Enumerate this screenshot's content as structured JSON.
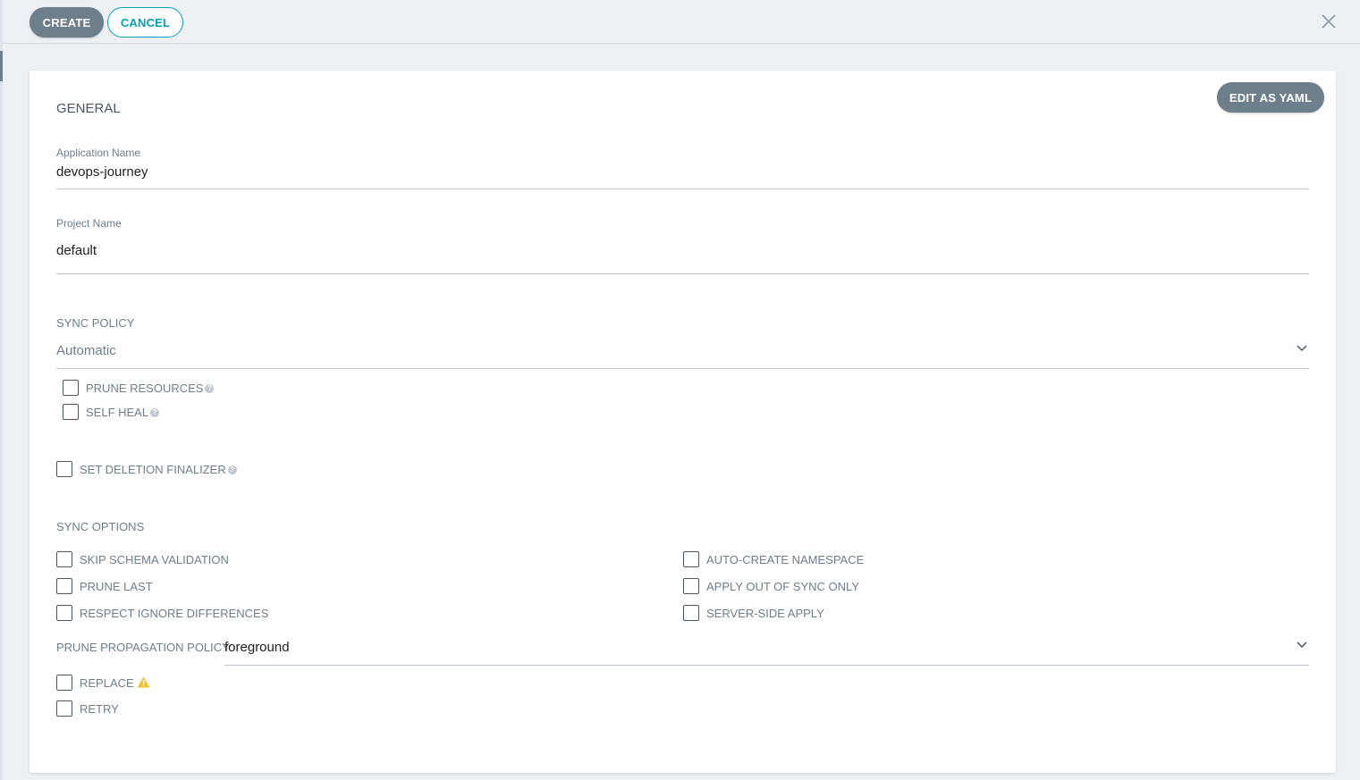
{
  "toolbar": {
    "create_label": "CREATE",
    "cancel_label": "CANCEL",
    "close_icon": "close-icon"
  },
  "panel": {
    "edit_yaml_label": "EDIT AS YAML",
    "general": {
      "title": "GENERAL",
      "application_name": {
        "label": "Application Name",
        "value": "devops-journey"
      },
      "project_name": {
        "label": "Project Name",
        "value": "default"
      }
    },
    "sync_policy": {
      "label": "SYNC POLICY",
      "selected": "Automatic",
      "options": [
        {
          "label": "PRUNE RESOURCES",
          "checked": false,
          "help": true
        },
        {
          "label": "SELF HEAL",
          "checked": false,
          "help": true
        }
      ]
    },
    "deletion_finalizer": {
      "label": "SET DELETION FINALIZER",
      "checked": false,
      "help": true
    },
    "sync_options": {
      "title": "SYNC OPTIONS",
      "left": [
        {
          "label": "SKIP SCHEMA VALIDATION",
          "checked": false
        },
        {
          "label": "PRUNE LAST",
          "checked": false
        },
        {
          "label": "RESPECT IGNORE DIFFERENCES",
          "checked": false
        }
      ],
      "right": [
        {
          "label": "AUTO-CREATE NAMESPACE",
          "checked": false
        },
        {
          "label": "APPLY OUT OF SYNC ONLY",
          "checked": false
        },
        {
          "label": "SERVER-SIDE APPLY",
          "checked": false
        }
      ],
      "prune_propagation_policy": {
        "label": "PRUNE PROPAGATION POLICY:",
        "selected": "foreground"
      },
      "replace": {
        "label": "REPLACE",
        "checked": false,
        "warning_icon": "warning-icon"
      },
      "retry": {
        "label": "RETRY",
        "checked": false
      }
    }
  },
  "colors": {
    "primary_button": "#6d7f8b",
    "accent": "#00a2b3",
    "warning": "#f4c030",
    "background": "#eef1f4"
  }
}
